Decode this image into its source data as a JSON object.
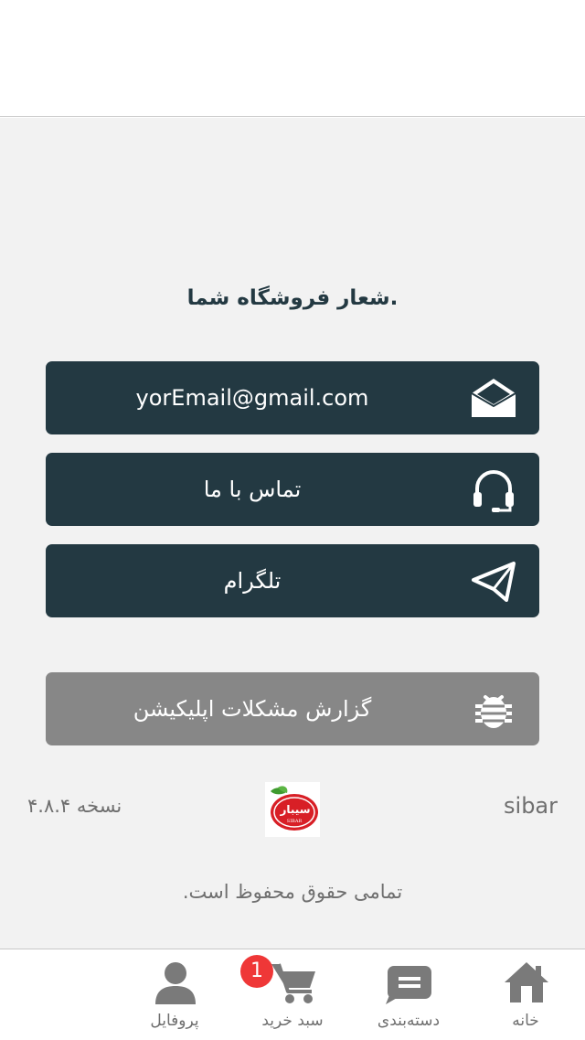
{
  "slogan": "شعار فروشگاه شما.",
  "buttons": {
    "email": {
      "label": "yorEmail@gmail.com",
      "icon": "envelope-open-icon"
    },
    "contact": {
      "label": "تماس با ما",
      "icon": "headset-icon"
    },
    "telegram": {
      "label": "تلگرام",
      "icon": "paper-plane-icon"
    },
    "report": {
      "label": "گزارش مشکلات اپلیکیشن",
      "icon": "bug-icon"
    }
  },
  "footer": {
    "brand": "sibar",
    "logo_text": "سیبار",
    "logo_subtext": "SIBAR",
    "version": "نسخه ۴.۸.۴",
    "copyright": "تمامی حقوق محفوظ است."
  },
  "nav": {
    "home": {
      "label": "خانه",
      "icon": "home-icon"
    },
    "categories": {
      "label": "دسته‌بندی",
      "icon": "category-icon"
    },
    "cart": {
      "label": "سبد خرید",
      "icon": "cart-icon",
      "badge": "1"
    },
    "profile": {
      "label": "پروفایل",
      "icon": "user-icon"
    }
  },
  "colors": {
    "primary": "#233942",
    "secondary_button": "#878787",
    "badge": "#ef3737",
    "background": "#f2f2f2",
    "nav_icon": "#7a7a7a"
  }
}
